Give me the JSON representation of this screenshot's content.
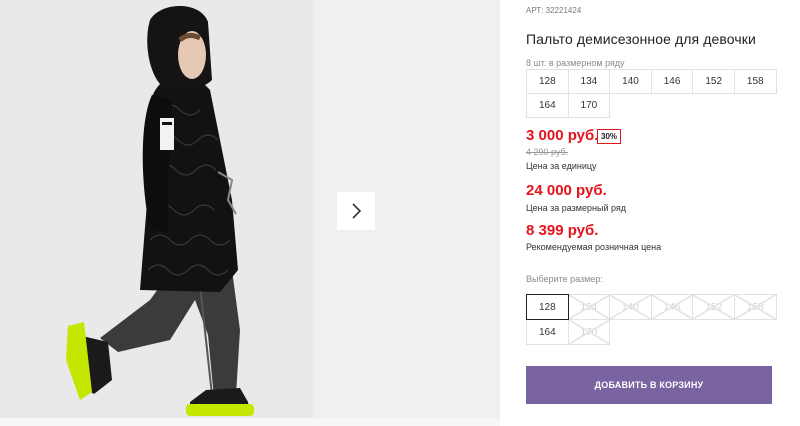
{
  "product": {
    "article_label": "АРТ:",
    "article_value": "32221424",
    "title": "Пальто демисезонное для девочки",
    "pack_label": "8 шт. в размерном ряду",
    "pack_sizes": [
      "128",
      "134",
      "140",
      "146",
      "152",
      "158",
      "164",
      "170"
    ]
  },
  "pricing": {
    "unit_price": "3 000 руб.",
    "discount": "30%",
    "old_price": "4 290 руб.",
    "unit_label": "Цена за единицу",
    "row_price": "24 000 руб.",
    "row_label": "Цена за размерный ряд",
    "rec_price": "8 399 руб.",
    "rec_label": "Рекомендуемая розничная цена"
  },
  "size_select": {
    "label": "Выберите размер:",
    "options": [
      {
        "label": "128",
        "state": "selected"
      },
      {
        "label": "134",
        "state": "disabled"
      },
      {
        "label": "140",
        "state": "disabled"
      },
      {
        "label": "146",
        "state": "disabled"
      },
      {
        "label": "152",
        "state": "disabled"
      },
      {
        "label": "158",
        "state": "disabled"
      },
      {
        "label": "164",
        "state": "available"
      },
      {
        "label": "170",
        "state": "disabled"
      }
    ]
  },
  "cart": {
    "add_label": "ДОБАВИТЬ В КОРЗИНУ"
  },
  "colors": {
    "price_red": "#e5131b",
    "button_purple": "#7a63a1",
    "photo_bg": "#e9e9e9",
    "coat": "#111111",
    "sole_lime": "#c4e600"
  },
  "icons": {
    "gallery_next": "chevron-right-icon"
  }
}
